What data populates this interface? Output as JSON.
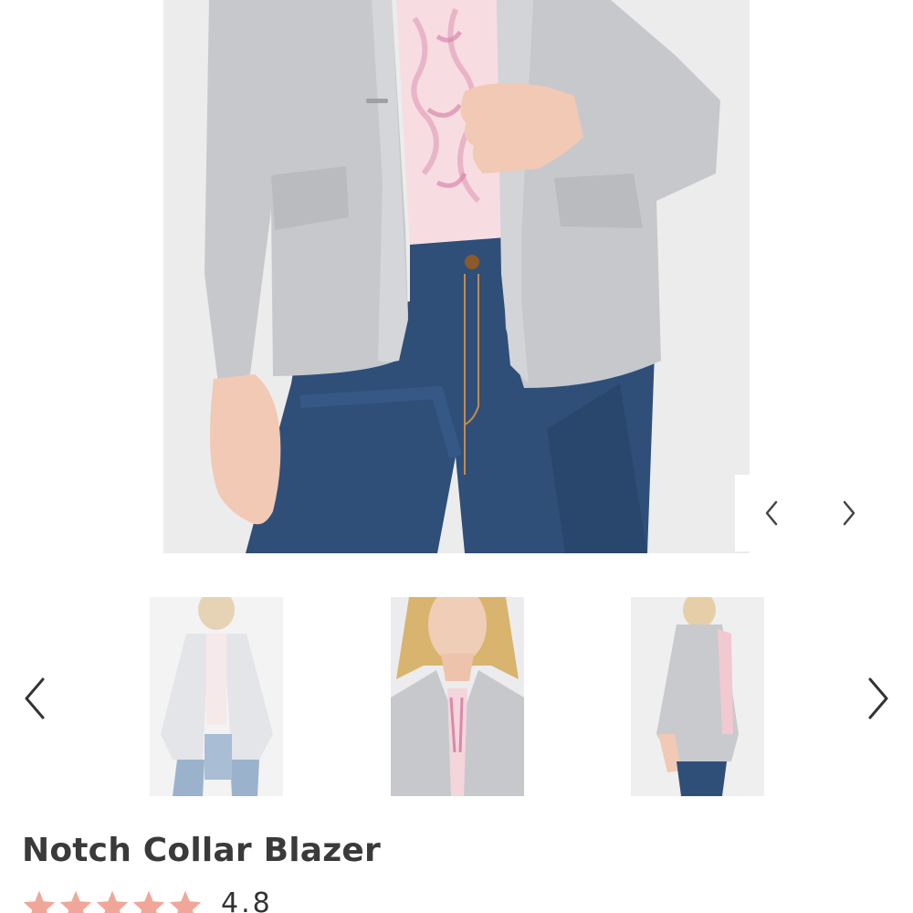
{
  "product": {
    "title": "Notch Collar Blazer",
    "rating": "4.8",
    "star_count": 5,
    "star_color": "#f0a79a"
  },
  "gallery": {
    "main_image": "model-wearing-gray-blazer-with-jeans",
    "prev_icon": "chevron-left-icon",
    "next_icon": "chevron-right-icon",
    "thumbnails": [
      {
        "image": "light-gray-blazer-front-full"
      },
      {
        "image": "blazer-collar-closeup"
      },
      {
        "image": "blazer-side-view"
      }
    ]
  },
  "colors": {
    "blazer": "#c4c6ca",
    "denim": "#2f4f78",
    "blouse": "#f6d9de",
    "skin": "#f1c9b4",
    "title": "#3a3a3a"
  }
}
